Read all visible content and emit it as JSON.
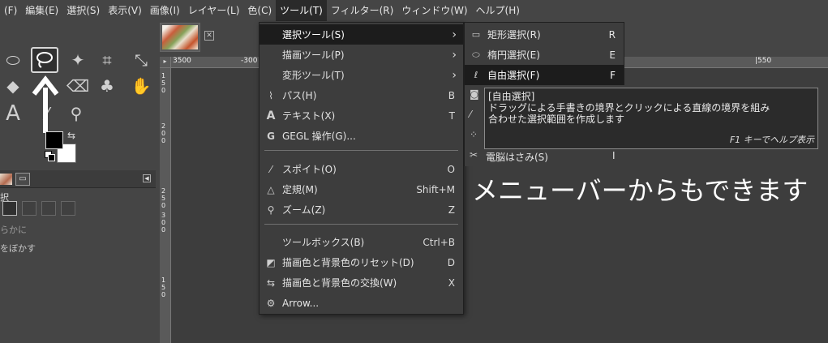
{
  "menubar": {
    "items": [
      "(F)",
      "編集(E)",
      "選択(S)",
      "表示(V)",
      "画像(I)",
      "レイヤー(L)",
      "色(C)",
      "ツール(T)",
      "フィルター(R)",
      "ウィンドウ(W)",
      "ヘルプ(H)"
    ],
    "active_index": 7
  },
  "tools_menu": {
    "items": [
      {
        "icon": "select-tools-icon",
        "label": "選択ツール(S)",
        "shortcut": "",
        "has_submenu": true
      },
      {
        "icon": "paint-tools-icon",
        "label": "描画ツール(P)",
        "shortcut": "",
        "has_submenu": true
      },
      {
        "icon": "transform-tools-icon",
        "label": "変形ツール(T)",
        "shortcut": "",
        "has_submenu": true
      },
      {
        "icon": "paths-icon",
        "label": "パス(H)",
        "shortcut": "B",
        "has_submenu": false
      },
      {
        "icon": "text-icon",
        "label": "テキスト(X)",
        "shortcut": "T",
        "has_submenu": false
      },
      {
        "icon": "gegl-icon",
        "label": "GEGL 操作(G)...",
        "shortcut": "",
        "has_submenu": false
      },
      {
        "icon": "color-picker-icon",
        "label": "スポイト(O)",
        "shortcut": "O",
        "has_submenu": false
      },
      {
        "icon": "measure-icon",
        "label": "定規(M)",
        "shortcut": "Shift+M",
        "has_submenu": false
      },
      {
        "icon": "zoom-icon",
        "label": "ズーム(Z)",
        "shortcut": "Z",
        "has_submenu": false
      },
      {
        "icon": "",
        "label": "ツールボックス(B)",
        "shortcut": "Ctrl+B",
        "has_submenu": false
      },
      {
        "icon": "reset-colors-icon",
        "label": "描画色と背景色のリセット(D)",
        "shortcut": "D",
        "has_submenu": false
      },
      {
        "icon": "swap-colors-icon",
        "label": "描画色と背景色の交換(W)",
        "shortcut": "X",
        "has_submenu": false
      },
      {
        "icon": "arrow-icon",
        "label": "Arrow...",
        "shortcut": "",
        "has_submenu": false
      }
    ]
  },
  "select_submenu": {
    "items": [
      {
        "icon": "rect-select-icon",
        "label": "矩形選択(R)",
        "shortcut": "R"
      },
      {
        "icon": "ellipse-select-icon",
        "label": "楕円選択(E)",
        "shortcut": "E"
      },
      {
        "icon": "free-select-icon",
        "label": "自由選択(F)",
        "shortcut": "F"
      }
    ],
    "partial_item": {
      "label": "電脳はさみ(S)",
      "shortcut": "I"
    }
  },
  "tooltip": {
    "title": "[自由選択]",
    "desc_line1": "ドラッグによる手書きの境界とクリックによる直線の境界を組み",
    "desc_line2": "合わせた選択範囲を作成します",
    "help": "F1 キーでヘルプ表示"
  },
  "caption": "メニューバーからもできます",
  "ruler": {
    "top_labels": [
      "3500",
      "-300",
      "|550"
    ],
    "left_labels": [
      "1",
      "5",
      "0",
      "2",
      "0",
      "0",
      "2",
      "5",
      "0",
      "3",
      "0",
      "0",
      "1",
      "5",
      "0"
    ]
  },
  "dock": {
    "title": "択",
    "option1": "らかに",
    "option2": "をぼかす"
  },
  "colors": {
    "foreground": "#000000",
    "background": "#ffffff",
    "menu_bg": "#3d3d3d",
    "highlight": "#1c1c1c"
  }
}
